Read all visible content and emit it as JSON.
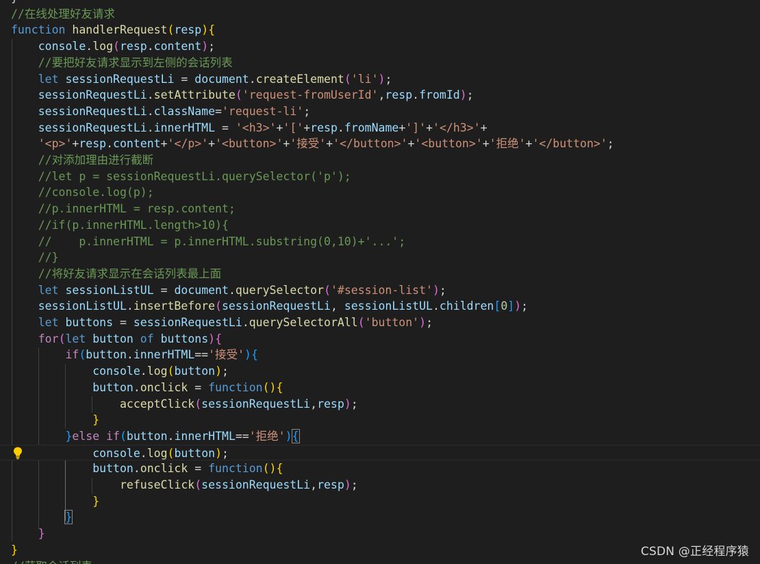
{
  "editor": {
    "theme": {
      "background": "#1e1e1e",
      "keyword": "#569cd6",
      "control": "#c586c0",
      "function": "#dcdcaa",
      "variable": "#9cdcfe",
      "constant": "#4fc1ff",
      "string": "#ce9178",
      "number": "#b5cea8",
      "comment": "#6a9955",
      "punctuation": "#d4d4d4",
      "bracket1": "#ffd700",
      "bracket2": "#da70d6",
      "bracket3": "#179fff"
    },
    "lines": [
      [
        [
          "pun",
          "}"
        ]
      ],
      [
        [
          "com",
          "//在线处理好友请求"
        ]
      ],
      [
        [
          "kw",
          "function"
        ],
        [
          "pun",
          " "
        ],
        [
          "fn",
          "handlerRequest"
        ],
        [
          "b1",
          "("
        ],
        [
          "var",
          "resp"
        ],
        [
          "b1",
          ")"
        ],
        [
          "b1",
          "{"
        ]
      ],
      [
        [
          "pun",
          "    "
        ],
        [
          "var",
          "console"
        ],
        [
          "pun",
          "."
        ],
        [
          "fn",
          "log"
        ],
        [
          "b2",
          "("
        ],
        [
          "var",
          "resp"
        ],
        [
          "pun",
          "."
        ],
        [
          "var",
          "content"
        ],
        [
          "b2",
          ")"
        ],
        [
          "pun",
          ";"
        ]
      ],
      [
        [
          "pun",
          "    "
        ],
        [
          "com",
          "//要把好友请求显示到左侧的会话列表"
        ]
      ],
      [
        [
          "pun",
          "    "
        ],
        [
          "kw",
          "let"
        ],
        [
          "pun",
          " "
        ],
        [
          "var",
          "sessionRequestLi"
        ],
        [
          "pun",
          " = "
        ],
        [
          "var",
          "document"
        ],
        [
          "pun",
          "."
        ],
        [
          "fn",
          "createElement"
        ],
        [
          "b2",
          "("
        ],
        [
          "str",
          "'li'"
        ],
        [
          "b2",
          ")"
        ],
        [
          "pun",
          ";"
        ]
      ],
      [
        [
          "pun",
          "    "
        ],
        [
          "var",
          "sessionRequestLi"
        ],
        [
          "pun",
          "."
        ],
        [
          "fn",
          "setAttribute"
        ],
        [
          "b2",
          "("
        ],
        [
          "str",
          "'request-fromUserId'"
        ],
        [
          "pun",
          ","
        ],
        [
          "var",
          "resp"
        ],
        [
          "pun",
          "."
        ],
        [
          "var",
          "fromId"
        ],
        [
          "b2",
          ")"
        ],
        [
          "pun",
          ";"
        ]
      ],
      [
        [
          "pun",
          "    "
        ],
        [
          "var",
          "sessionRequestLi"
        ],
        [
          "pun",
          "."
        ],
        [
          "var",
          "className"
        ],
        [
          "pun",
          "="
        ],
        [
          "str",
          "'request-li'"
        ],
        [
          "pun",
          ";"
        ]
      ],
      [
        [
          "pun",
          "    "
        ],
        [
          "var",
          "sessionRequestLi"
        ],
        [
          "pun",
          "."
        ],
        [
          "var",
          "innerHTML"
        ],
        [
          "pun",
          " = "
        ],
        [
          "str",
          "'<h3>'"
        ],
        [
          "pun",
          "+"
        ],
        [
          "str",
          "'['"
        ],
        [
          "pun",
          "+"
        ],
        [
          "var",
          "resp"
        ],
        [
          "pun",
          "."
        ],
        [
          "var",
          "fromName"
        ],
        [
          "pun",
          "+"
        ],
        [
          "str",
          "']'"
        ],
        [
          "pun",
          "+"
        ],
        [
          "str",
          "'</h3>'"
        ],
        [
          "pun",
          "+"
        ]
      ],
      [
        [
          "pun",
          "    "
        ],
        [
          "str",
          "'<p>'"
        ],
        [
          "pun",
          "+"
        ],
        [
          "var",
          "resp"
        ],
        [
          "pun",
          "."
        ],
        [
          "var",
          "content"
        ],
        [
          "pun",
          "+"
        ],
        [
          "str",
          "'</p>'"
        ],
        [
          "pun",
          "+"
        ],
        [
          "str",
          "'<button>'"
        ],
        [
          "pun",
          "+"
        ],
        [
          "str",
          "'接受'"
        ],
        [
          "pun",
          "+"
        ],
        [
          "str",
          "'</button>'"
        ],
        [
          "pun",
          "+"
        ],
        [
          "str",
          "'<button>'"
        ],
        [
          "pun",
          "+"
        ],
        [
          "str",
          "'拒绝'"
        ],
        [
          "pun",
          "+"
        ],
        [
          "str",
          "'</button>'"
        ],
        [
          "pun",
          ";"
        ]
      ],
      [
        [
          "pun",
          "    "
        ],
        [
          "com",
          "//对添加理由进行截断"
        ]
      ],
      [
        [
          "pun",
          "    "
        ],
        [
          "com",
          "//let p = sessionRequestLi.querySelector('p');"
        ]
      ],
      [
        [
          "pun",
          "    "
        ],
        [
          "com",
          "//console.log(p);"
        ]
      ],
      [
        [
          "pun",
          "    "
        ],
        [
          "com",
          "//p.innerHTML = resp.content;"
        ]
      ],
      [
        [
          "pun",
          "    "
        ],
        [
          "com",
          "//if(p.innerHTML.length>10){"
        ]
      ],
      [
        [
          "pun",
          "    "
        ],
        [
          "com",
          "//    p.innerHTML = p.innerHTML.substring(0,10)+'...';"
        ]
      ],
      [
        [
          "pun",
          "    "
        ],
        [
          "com",
          "//}"
        ]
      ],
      [
        [
          "pun",
          "    "
        ],
        [
          "com",
          "//将好友请求显示在会话列表最上面"
        ]
      ],
      [
        [
          "pun",
          "    "
        ],
        [
          "kw",
          "let"
        ],
        [
          "pun",
          " "
        ],
        [
          "var",
          "sessionListUL"
        ],
        [
          "pun",
          " = "
        ],
        [
          "var",
          "document"
        ],
        [
          "pun",
          "."
        ],
        [
          "fn",
          "querySelector"
        ],
        [
          "b2",
          "("
        ],
        [
          "str",
          "'#session-list'"
        ],
        [
          "b2",
          ")"
        ],
        [
          "pun",
          ";"
        ]
      ],
      [
        [
          "pun",
          "    "
        ],
        [
          "var",
          "sessionListUL"
        ],
        [
          "pun",
          "."
        ],
        [
          "fn",
          "insertBefore"
        ],
        [
          "b2",
          "("
        ],
        [
          "var",
          "sessionRequestLi"
        ],
        [
          "pun",
          ", "
        ],
        [
          "var",
          "sessionListUL"
        ],
        [
          "pun",
          "."
        ],
        [
          "var",
          "children"
        ],
        [
          "b3",
          "["
        ],
        [
          "num",
          "0"
        ],
        [
          "b3",
          "]"
        ],
        [
          "b2",
          ")"
        ],
        [
          "pun",
          ";"
        ]
      ],
      [
        [
          "pun",
          "    "
        ],
        [
          "kw",
          "let"
        ],
        [
          "pun",
          " "
        ],
        [
          "var",
          "buttons"
        ],
        [
          "pun",
          " = "
        ],
        [
          "var",
          "sessionRequestLi"
        ],
        [
          "pun",
          "."
        ],
        [
          "fn",
          "querySelectorAll"
        ],
        [
          "b2",
          "("
        ],
        [
          "str",
          "'button'"
        ],
        [
          "b2",
          ")"
        ],
        [
          "pun",
          ";"
        ]
      ],
      [
        [
          "pun",
          "    "
        ],
        [
          "ctl",
          "for"
        ],
        [
          "b2",
          "("
        ],
        [
          "kw",
          "let"
        ],
        [
          "pun",
          " "
        ],
        [
          "var",
          "button"
        ],
        [
          "pun",
          " "
        ],
        [
          "kw",
          "of"
        ],
        [
          "pun",
          " "
        ],
        [
          "var",
          "buttons"
        ],
        [
          "b2",
          ")"
        ],
        [
          "b2",
          "{"
        ]
      ],
      [
        [
          "pun",
          "        "
        ],
        [
          "ctl",
          "if"
        ],
        [
          "b3",
          "("
        ],
        [
          "var",
          "button"
        ],
        [
          "pun",
          "."
        ],
        [
          "var",
          "innerHTML"
        ],
        [
          "pun",
          "=="
        ],
        [
          "str",
          "'接受'"
        ],
        [
          "b3",
          ")"
        ],
        [
          "b3",
          "{"
        ]
      ],
      [
        [
          "pun",
          "            "
        ],
        [
          "var",
          "console"
        ],
        [
          "pun",
          "."
        ],
        [
          "fn",
          "log"
        ],
        [
          "b1",
          "("
        ],
        [
          "var",
          "button"
        ],
        [
          "b1",
          ")"
        ],
        [
          "pun",
          ";"
        ]
      ],
      [
        [
          "pun",
          "            "
        ],
        [
          "var",
          "button"
        ],
        [
          "pun",
          "."
        ],
        [
          "fn",
          "onclick"
        ],
        [
          "pun",
          " = "
        ],
        [
          "kw",
          "function"
        ],
        [
          "b1",
          "("
        ],
        [
          "b1",
          ")"
        ],
        [
          "b1",
          "{"
        ]
      ],
      [
        [
          "pun",
          "                "
        ],
        [
          "fn",
          "acceptClick"
        ],
        [
          "b2",
          "("
        ],
        [
          "var",
          "sessionRequestLi"
        ],
        [
          "pun",
          ","
        ],
        [
          "var",
          "resp"
        ],
        [
          "b2",
          ")"
        ],
        [
          "pun",
          ";"
        ]
      ],
      [
        [
          "pun",
          "            "
        ],
        [
          "b1",
          "}"
        ]
      ],
      [
        [
          "pun",
          "        "
        ],
        [
          "b3",
          "}"
        ],
        [
          "ctl",
          "else"
        ],
        [
          "pun",
          " "
        ],
        [
          "ctl",
          "if"
        ],
        [
          "b3",
          "("
        ],
        [
          "var",
          "button"
        ],
        [
          "pun",
          "."
        ],
        [
          "var",
          "innerHTML"
        ],
        [
          "pun",
          "=="
        ],
        [
          "str",
          "'拒绝'"
        ],
        [
          "b3",
          ")"
        ],
        [
          "b3h",
          "{"
        ]
      ],
      [
        [
          "pun",
          "            "
        ],
        [
          "var",
          "console"
        ],
        [
          "pun",
          "."
        ],
        [
          "fn",
          "log"
        ],
        [
          "b1",
          "("
        ],
        [
          "var",
          "button"
        ],
        [
          "b1",
          ")"
        ],
        [
          "pun",
          ";"
        ]
      ],
      [
        [
          "pun",
          "            "
        ],
        [
          "var",
          "button"
        ],
        [
          "pun",
          "."
        ],
        [
          "fn",
          "onclick"
        ],
        [
          "pun",
          " = "
        ],
        [
          "kw",
          "function"
        ],
        [
          "b1",
          "("
        ],
        [
          "b1",
          ")"
        ],
        [
          "b1",
          "{"
        ]
      ],
      [
        [
          "pun",
          "                "
        ],
        [
          "fn",
          "refuseClick"
        ],
        [
          "b2",
          "("
        ],
        [
          "var",
          "sessionRequestLi"
        ],
        [
          "pun",
          ","
        ],
        [
          "var",
          "resp"
        ],
        [
          "b2",
          ")"
        ],
        [
          "pun",
          ";"
        ]
      ],
      [
        [
          "pun",
          "            "
        ],
        [
          "b1",
          "}"
        ]
      ],
      [
        [
          "pun",
          "        "
        ],
        [
          "b3h",
          "}"
        ]
      ],
      [
        [
          "pun",
          "    "
        ],
        [
          "b2",
          "}"
        ]
      ],
      [
        [
          "b1",
          "}"
        ]
      ],
      [
        [
          "com",
          "//获取会话列表"
        ]
      ]
    ],
    "lightbulb_icon": "lightbulb-icon"
  },
  "watermark": {
    "text": "CSDN @正经程序猿"
  }
}
